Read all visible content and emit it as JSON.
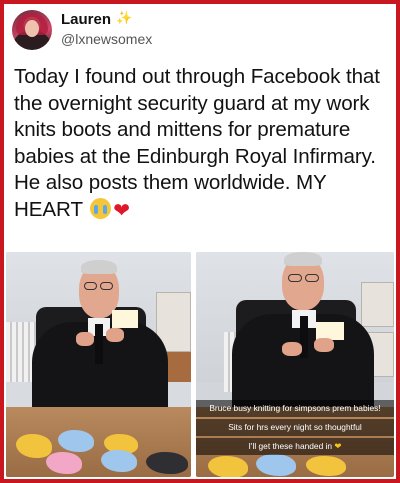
{
  "post": {
    "author_name": "Lauren",
    "author_badge_icon": "sparkles-icon",
    "author_handle": "@lxnewsomex",
    "text": "Today I found out through Facebook that the overnight security guard at my work knits boots and mittens for premature babies at the Edinburgh Royal Infirmary. He also posts them worldwide. MY HEART",
    "text_emojis": [
      "loudly-crying-face-icon",
      "red-heart-icon"
    ]
  },
  "photos": {
    "left": {
      "subject": "security-guard-knitting-photo"
    },
    "right": {
      "subject": "security-guard-knitting-snapchat-photo",
      "captions": [
        "Bruce busy knitting for simpsons prem babies!",
        "Sits for hrs every night so thoughtful",
        "I'll get these handed in"
      ],
      "caption_emoji": "yellow-heart-icon"
    }
  },
  "colors": {
    "frame": "#c8171f",
    "card": "#ffffff",
    "text": "#121212",
    "handle": "#555555"
  }
}
